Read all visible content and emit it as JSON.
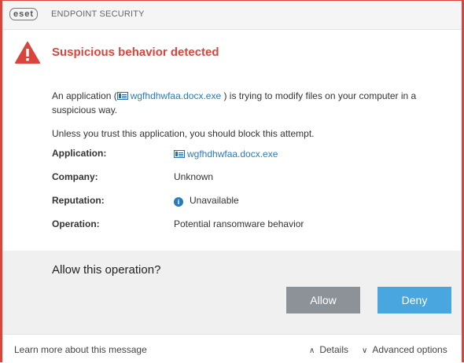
{
  "titlebar": {
    "logo_text": "eset",
    "product_name": "ENDPOINT SECURITY"
  },
  "header": {
    "title": "Suspicious behavior detected",
    "icon": "warning-triangle-icon"
  },
  "message": {
    "line1_prefix": "An application (",
    "app_name": "wgfhdhwfaa.docx.exe",
    "line1_suffix": ") is trying to modify files on your computer in a",
    "line2": "suspicious way.",
    "recommendation": "Unless you trust this application, you should block this attempt."
  },
  "details": [
    {
      "label": "Application:",
      "value": "wgfhdhwfaa.docx.exe"
    },
    {
      "label": "Company:",
      "value": "Unknown"
    },
    {
      "label": "Reputation:",
      "value": "Unavailable"
    },
    {
      "label": "Operation:",
      "value": "Potential ransomware behavior"
    }
  ],
  "actions": {
    "question": "Allow this operation?",
    "allow_label": "Allow",
    "deny_label": "Deny"
  },
  "footer": {
    "learn_more": "Learn more about this message",
    "details": "Details",
    "advanced": "Advanced options"
  },
  "colors": {
    "alert_red": "#d9453d",
    "link_blue": "#2a7ab8",
    "deny_blue": "#4aa6de",
    "allow_gray": "#8c9298"
  }
}
